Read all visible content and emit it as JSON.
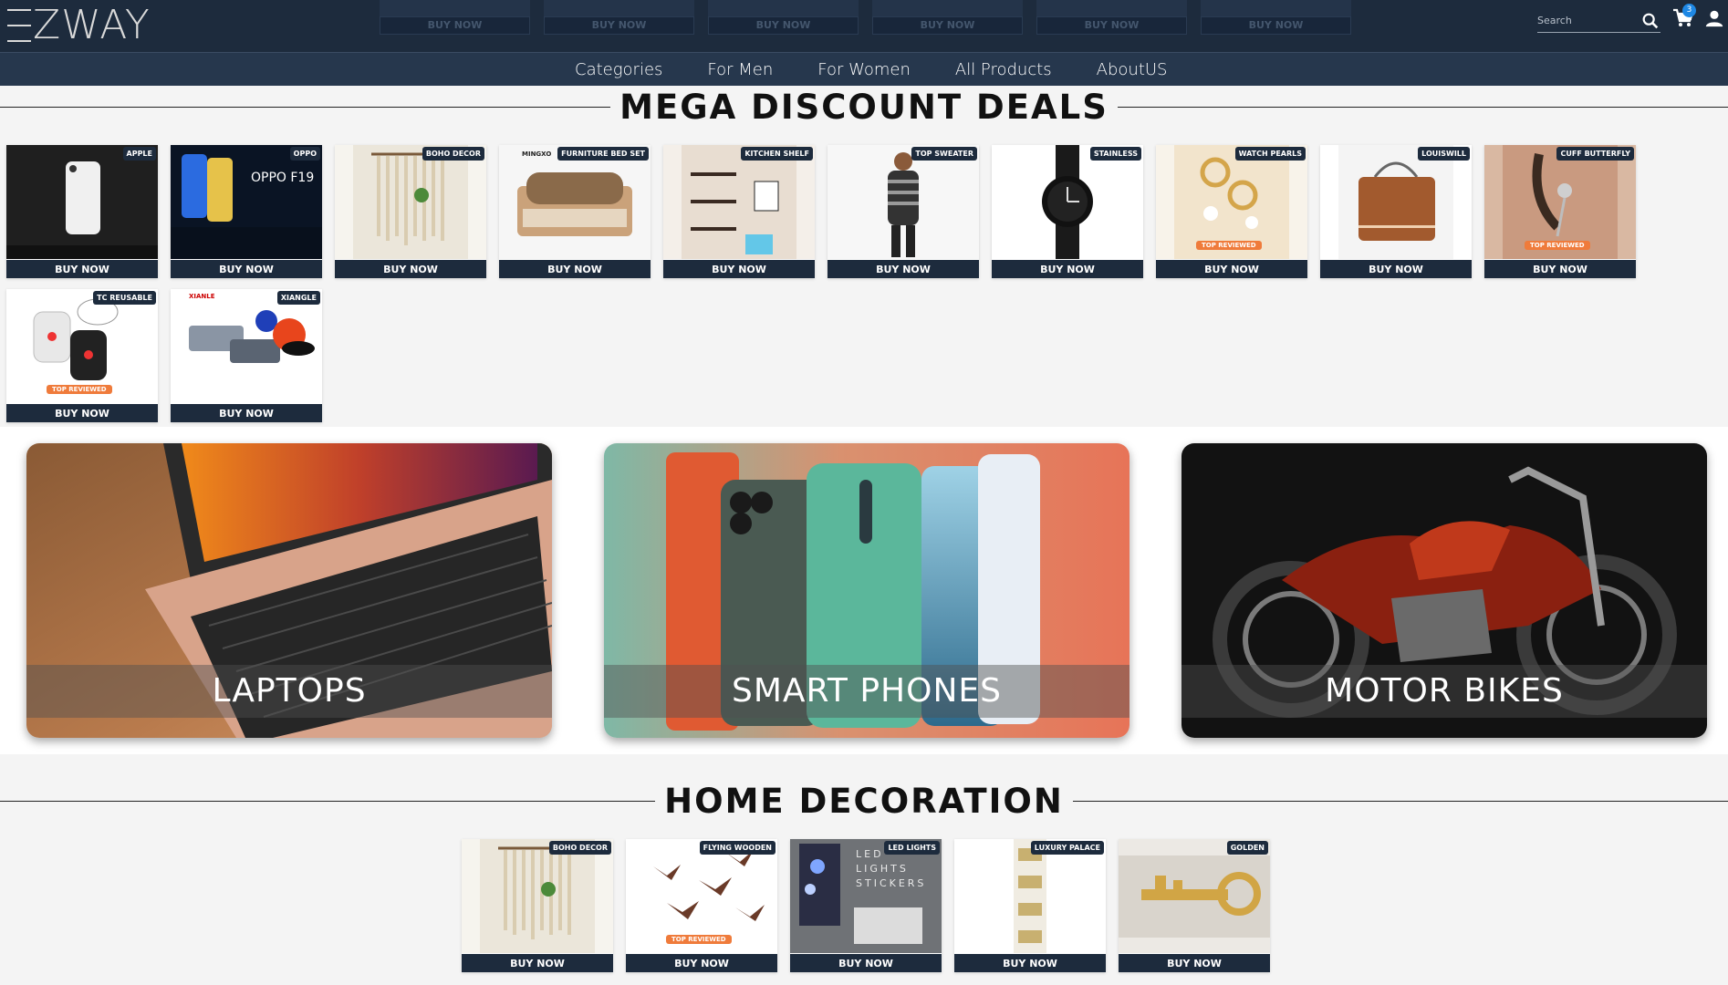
{
  "header": {
    "logo": "ZWAY",
    "search_placeholder": "Search",
    "cart_count": "3",
    "ghost_buy_label": "BUY NOW",
    "bg_color": "#1d2b3d"
  },
  "nav": {
    "items": [
      {
        "label": "Categories"
      },
      {
        "label": "For Men"
      },
      {
        "label": "For Women"
      },
      {
        "label": "All Products"
      },
      {
        "label": "AboutUS"
      }
    ]
  },
  "mega_deals": {
    "title": "MEGA DISCOUNT DEALS",
    "products": [
      {
        "tag": "APPLE",
        "button": "BUY NOW",
        "image": "phone-image"
      },
      {
        "tag": "OPPO",
        "button": "BUY NOW",
        "image": "oppo-image",
        "image_text": "OPPO F19"
      },
      {
        "tag": "BOHO DECOR",
        "button": "BUY NOW",
        "image": "macrame-image"
      },
      {
        "tag": "FURNITURE BED SET",
        "button": "BUY NOW",
        "image": "bed-image"
      },
      {
        "tag": "KITCHEN SHELF",
        "button": "BUY NOW",
        "image": "shelf-image"
      },
      {
        "tag": "TOP SWEATER",
        "button": "BUY NOW",
        "image": "sweater-image"
      },
      {
        "tag": "STAINLESS",
        "button": "BUY NOW",
        "image": "watch-image"
      },
      {
        "tag": "WATCH PEARLS",
        "button": "BUY NOW",
        "image": "bracelet-image",
        "ribbon": "TOP REVIEWED"
      },
      {
        "tag": "LOUISWILL",
        "button": "BUY NOW",
        "image": "bag-image"
      },
      {
        "tag": "CUFF BUTTERFLY",
        "button": "BUY NOW",
        "image": "earring-image",
        "ribbon": "TOP REVIEWED"
      },
      {
        "tag": "TC REUSABLE",
        "button": "BUY NOW",
        "image": "charger-image",
        "ribbon": "TOP REVIEWED"
      },
      {
        "tag": "XIANGLE",
        "button": "BUY NOW",
        "image": "clamp-image"
      }
    ]
  },
  "categories": [
    {
      "label": "LAPTOPS"
    },
    {
      "label": "SMART PHONES"
    },
    {
      "label": "MOTOR BIKES"
    }
  ],
  "home_decoration": {
    "title": "HOME DECORATION",
    "products": [
      {
        "tag": "BOHO DECOR",
        "button": "BUY NOW",
        "image": "macrame-image"
      },
      {
        "tag": "FLYING WOODEN",
        "button": "BUY NOW",
        "image": "birds-image",
        "ribbon": "TOP REVIEWED"
      },
      {
        "tag": "LED LIGHTS",
        "button": "BUY NOW",
        "image": "led-image",
        "image_text": "LED LIGHTS STICKERS"
      },
      {
        "tag": "LUXURY PALACE",
        "button": "BUY NOW",
        "image": "palace-image"
      },
      {
        "tag": "GOLDEN",
        "button": "BUY NOW",
        "image": "key-image"
      }
    ]
  }
}
